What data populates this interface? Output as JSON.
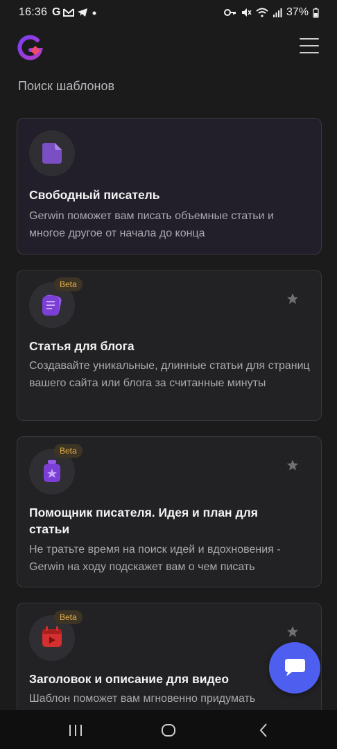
{
  "status_bar": {
    "time": "16:36",
    "notification_icons": [
      "google-icon",
      "gmail-icon",
      "telegram-icon",
      "dot-icon"
    ],
    "system_icons": [
      "key-icon",
      "mute-icon",
      "wifi-icon",
      "signal-icon"
    ],
    "battery": "37%"
  },
  "header": {
    "logo": "gerwin-logo",
    "menu_icon": "hamburger-menu-icon"
  },
  "search": {
    "label": "Поиск шаблонов"
  },
  "cards": [
    {
      "title": "Свободный писатель",
      "description": "Gerwin поможет вам писать объемные статьи и многое другое от начала до конца",
      "icon": "document-icon",
      "badge": "",
      "starred": false
    },
    {
      "title": "Статья для блога",
      "description": "Создавайте уникальные, длинные статьи для страниц вашего сайта или блога за считанные минуты",
      "icon": "blog-article-icon",
      "badge": "Beta",
      "starred": false
    },
    {
      "title": "Помощник писателя. Идея и план для статьи",
      "description": "Не тратьте время на поиск идей и вдохновения - Gerwin на ходу подскажет вам о чем писать",
      "icon": "idea-lamp-icon",
      "badge": "Beta",
      "starred": false
    },
    {
      "title": "Заголовок и описание для видео",
      "description": "Шаблон поможет вам мгновенно придумать",
      "icon": "video-calendar-icon",
      "badge": "Beta",
      "starred": false
    }
  ],
  "colors": {
    "background": "#1b1b1c",
    "card": "#222224",
    "accent_purple": "#7b4fc4",
    "badge_text": "#e5b04b",
    "fab": "#4e5ff0",
    "video_icon": "#d32f2f"
  },
  "nav_bar": {
    "buttons": [
      "recents-icon",
      "home-icon",
      "back-icon"
    ]
  }
}
